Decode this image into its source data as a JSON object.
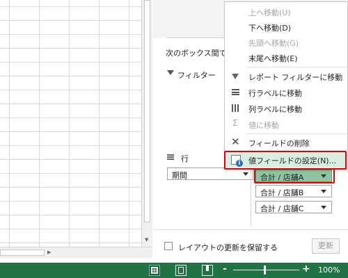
{
  "pane": {
    "move_label": "次のボックス間でフ",
    "filter_label": "フィルター",
    "rows_label": "行",
    "row_field": "期間",
    "values": [
      "合計 / 店舗A",
      "合計 / 店舗B",
      "合計 / 店舗C"
    ],
    "defer_label": "レイアウトの更新を保留する",
    "update_button": "更新"
  },
  "menu": {
    "items": [
      {
        "label": "上へ移動(U)",
        "icon": "none",
        "disabled": true
      },
      {
        "label": "下へ移動(D)",
        "icon": "none",
        "disabled": false
      },
      {
        "label": "先頭へ移動(G)",
        "icon": "none",
        "disabled": true
      },
      {
        "label": "末尾へ移動(E)",
        "icon": "none",
        "disabled": false
      },
      {
        "label": "レポート フィルターに移動",
        "icon": "filter-icon",
        "disabled": false
      },
      {
        "label": "行ラベルに移動",
        "icon": "rows-icon",
        "disabled": false
      },
      {
        "label": "列ラベルに移動",
        "icon": "columns-icon",
        "disabled": false
      },
      {
        "label": "値に移動",
        "icon": "sigma-icon",
        "disabled": true
      },
      {
        "label": "フィールドの削除",
        "icon": "remove-icon",
        "disabled": false
      },
      {
        "label": "値フィールドの設定(N)...",
        "icon": "value-settings-icon",
        "disabled": false
      }
    ],
    "highlight_color": "#e00000",
    "hover_color": "#d9eee2"
  },
  "statusbar": {
    "zoom_minus": "-",
    "zoom_plus": "+",
    "zoom_level": "100%",
    "zoom_value": 100,
    "color": "#217346"
  }
}
